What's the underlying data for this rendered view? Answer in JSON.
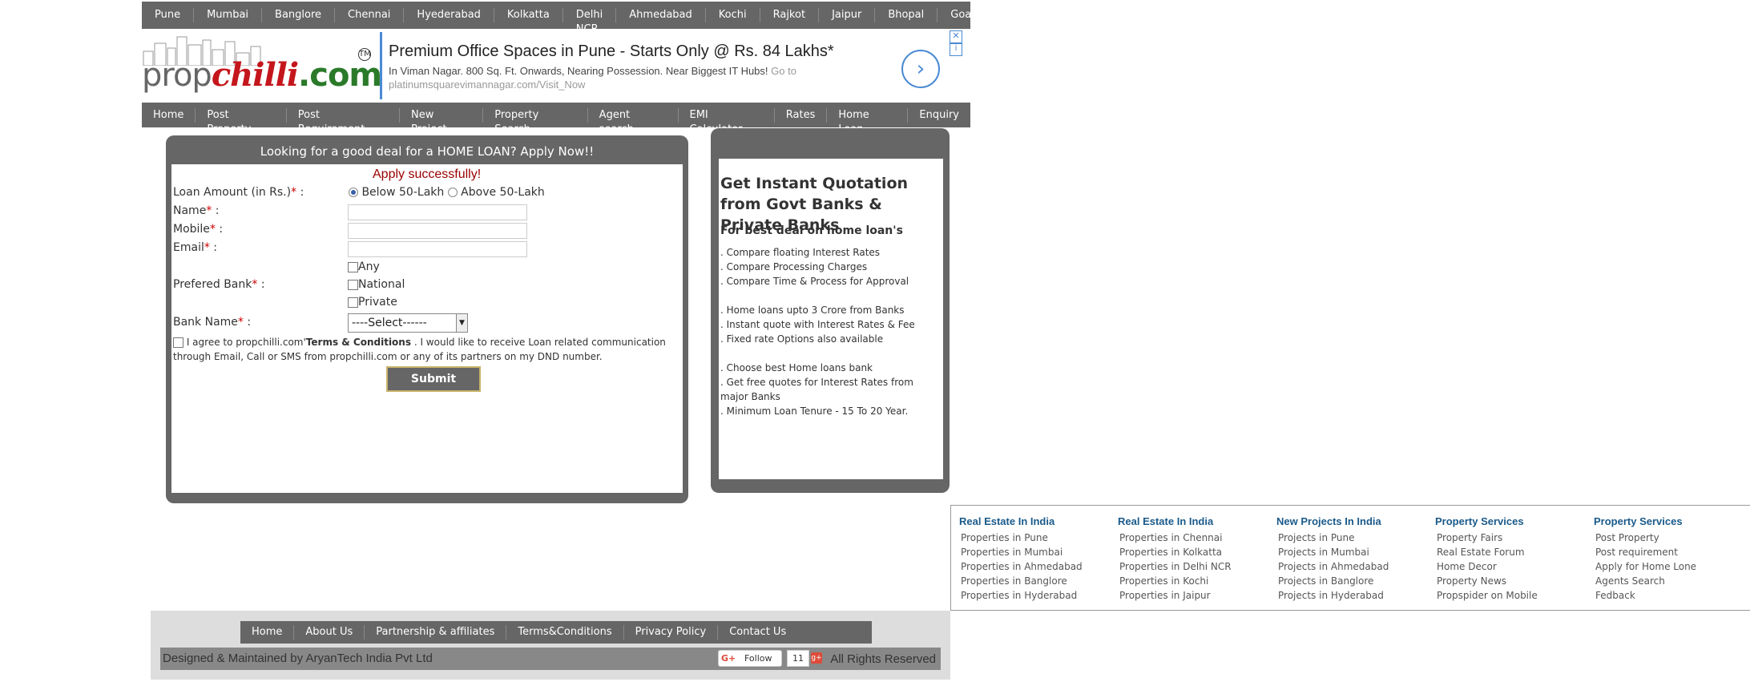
{
  "cities": [
    "Pune",
    "Mumbai",
    "Banglore",
    "Chennai",
    "Hyederabad",
    "Kolkatta",
    "Delhi NCR",
    "Ahmedabad",
    "Kochi",
    "Rajkot",
    "Jaipur",
    "Bhopal",
    "Goa"
  ],
  "logo": {
    "prop": "prop",
    "chilli": "chilli",
    "com": ".com",
    "tm": "TM"
  },
  "ad": {
    "title": "Premium Office Spaces in Pune - Starts Only @ Rs. 84 Lakhs*",
    "desc": "In Viman Nagar. 800 Sq. Ft. Onwards, Nearing Possession. Near Biggest IT Hubs!",
    "go": "Go to",
    "url": "platinumsquarevimannagar.com/Visit_Now",
    "arrow": "›",
    "close": "✕",
    "info": "i"
  },
  "mainnav": [
    "Home",
    "Post Property",
    "Post Requirement",
    "New Project",
    "Property Search",
    "Agent search",
    "EMI Calculator",
    "Rates",
    "Home Loan",
    "Enquiry"
  ],
  "loan": {
    "heading": "Looking for a good deal for a HOME LOAN? Apply Now!!",
    "success": "Apply successfully!",
    "amount_label": "Loan Amount (in Rs.)",
    "radio1": "Below 50-Lakh",
    "radio2": "Above 50-Lakh",
    "name_label": "Name",
    "mobile_label": "Mobile",
    "email_label": "Email",
    "bank_pref_label": "Prefered Bank",
    "bank_any": "Any",
    "bank_national": "National",
    "bank_private": "Private",
    "bank_name_label": "Bank Name",
    "select_value": "----Select------",
    "agree_pre": "I agree to propchilli.com'",
    "agree_terms": "Terms & Conditions",
    "agree_post": ". I would like to receive Loan related communication",
    "agree_line2": "through Email, Call or SMS from propchilli.com or any of its partners on my DND number.",
    "submit": "Submit Details",
    "star": "*",
    "colon": ":"
  },
  "quote": {
    "title": "Get Instant Quotation from Govt Banks & Private Banks",
    "sub": "For best deal on home loan's",
    "points": [
      ". Compare floating Interest Rates",
      ". Compare Processing Charges",
      ". Compare Time & Process for Approval",
      ". Home loans upto 3 Crore from Banks",
      ". Instant quote with Interest Rates & Fee",
      ". Fixed rate Options also available",
      ". Choose best Home loans bank",
      ". Get free quotes for Interest Rates from major Banks",
      ". Minimum Loan Tenure - 15 To 20 Year."
    ]
  },
  "footer_cols": [
    {
      "heading": "Real Estate In India",
      "items": [
        "Properties in Pune",
        "Properties in  Mumbai",
        "Properties in Ahmedabad",
        "Properties in Banglore",
        "Properties in Hyderabad"
      ]
    },
    {
      "heading": "Real Estate In India",
      "items": [
        "Properties in Chennai",
        "Properties in Kolkatta",
        "Properties in Delhi NCR",
        "Properties in Kochi",
        "Properties in Jaipur"
      ]
    },
    {
      "heading": "New Projects In India",
      "items": [
        "Projects in Pune",
        "Projects in Mumbai",
        "Projects in Ahmedabad",
        "Projects in Banglore",
        "Projects in Hyderabad"
      ]
    },
    {
      "heading": "Property Services",
      "items": [
        "Property Fairs",
        "Real Estate Forum",
        "Home Decor",
        "Property News",
        "Propspider on Mobile"
      ]
    },
    {
      "heading": "Property Services",
      "items": [
        "Post Property",
        "Post requirement",
        "Apply for Home Lone",
        "Agents Search",
        "Fedback"
      ]
    }
  ],
  "bottomnav": [
    "Home",
    "About Us",
    "Partnership & affiliates",
    "Terms&Conditions",
    "Privacy Policy",
    "Contact Us"
  ],
  "bottom": {
    "designed": "Designed & Maintained by AryanTech India Pvt Ltd",
    "follow": "Follow",
    "follow_g": "G+",
    "count": "11",
    "gplus": "g+",
    "rights": "All Rights Reserved"
  }
}
